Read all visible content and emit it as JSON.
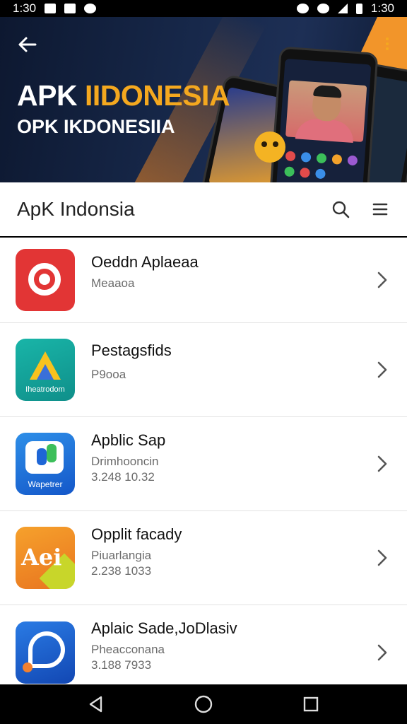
{
  "status_bar": {
    "time_left": "1:30",
    "time_right": "1:30"
  },
  "banner": {
    "title_line1_a": "APK ",
    "title_line1_b": "IIDONESIA",
    "title_line2": "OPK IKDONESIIA"
  },
  "appbar": {
    "title": "ApK Indonsia",
    "search_icon": "search-icon",
    "menu_icon": "menu-icon"
  },
  "apps": [
    {
      "name": "Oeddn Aplaeaa",
      "subtitle": "Meaaoa",
      "size": "",
      "icon": "red-ring-app-icon",
      "icon_label": ""
    },
    {
      "name": "Pestagsfids",
      "subtitle": "P9ooa",
      "size": "",
      "icon": "teal-triangle-app-icon",
      "icon_label": "Iheatrodom"
    },
    {
      "name": "Apblic Sap",
      "subtitle": "Drimhooncin",
      "size": "3.248 10.32",
      "icon": "blue-card-app-icon",
      "icon_label": "Wapetrer"
    },
    {
      "name": "Opplit facady",
      "subtitle": "Piuarlangia",
      "size": "2.238 1033",
      "icon": "orange-text-app-icon",
      "icon_label": "Aei"
    },
    {
      "name": "Aplaic Sade,JoDlasiv",
      "subtitle": "Pheacconana",
      "size": "3.188 7933",
      "icon": "blue-bubble-app-icon",
      "icon_label": ""
    }
  ],
  "colors": {
    "accent": "#f4a81f",
    "banner_bg": "#17284a",
    "list_bg": "#ffffff"
  }
}
